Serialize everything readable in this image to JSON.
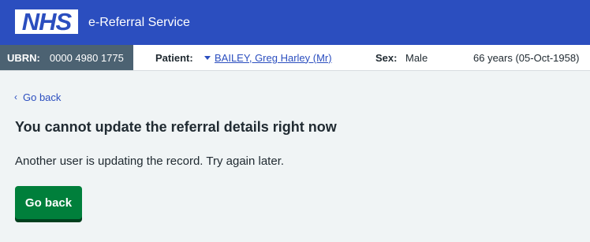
{
  "header": {
    "logo_text": "NHS",
    "service_name": "e-Referral Service"
  },
  "patient_banner": {
    "ubrn_label": "UBRN:",
    "ubrn_value": "0000 4980 1775",
    "patient_label": "Patient:",
    "patient_name": "BAILEY, Greg Harley (Mr)",
    "sex_label": "Sex:",
    "sex_value": "Male",
    "age_dob": "66 years (05-Oct-1958)"
  },
  "main": {
    "back_link": "Go back",
    "title": "You cannot update the referral details right now",
    "message": "Another user is updating the record. Try again later.",
    "button_label": "Go back"
  },
  "icons": {
    "back": "chevron-left-icon",
    "patient_menu": "caret-down-icon"
  },
  "colors": {
    "header_bg": "#2b4ebf",
    "ubrn_bg": "#4c6272",
    "link": "#2b4ebf",
    "button_bg": "#007f3b",
    "page_bg": "#f0f4f5"
  }
}
